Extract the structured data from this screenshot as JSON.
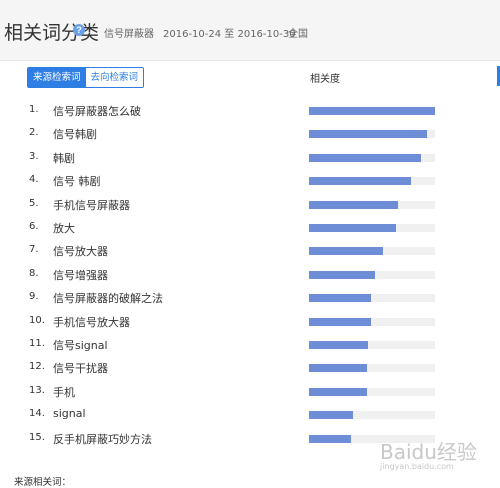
{
  "header": {
    "title": "相关词分类",
    "keyword": "信号屏蔽器",
    "date_range": "2016-10-24 至 2016-10-30",
    "region": "全国",
    "help_icon": "question-circle-icon"
  },
  "tabs": [
    {
      "label": "来源检索词",
      "active": true
    },
    {
      "label": "去向检索词",
      "active": false
    }
  ],
  "column_header": "相关度",
  "rows": [
    {
      "rank": "1.",
      "term": "信号屏蔽器怎么破",
      "relevance": 1.0
    },
    {
      "rank": "2.",
      "term": "信号韩剧",
      "relevance": 0.94
    },
    {
      "rank": "3.",
      "term": "韩剧",
      "relevance": 0.89
    },
    {
      "rank": "4.",
      "term": "信号 韩剧",
      "relevance": 0.81
    },
    {
      "rank": "5.",
      "term": "手机信号屏蔽器",
      "relevance": 0.71
    },
    {
      "rank": "6.",
      "term": "放大",
      "relevance": 0.69
    },
    {
      "rank": "7.",
      "term": "信号放大器",
      "relevance": 0.59
    },
    {
      "rank": "8.",
      "term": "信号增强器",
      "relevance": 0.52
    },
    {
      "rank": "9.",
      "term": "信号屏蔽器的破解之法",
      "relevance": 0.49
    },
    {
      "rank": "10.",
      "term": "手机信号放大器",
      "relevance": 0.49
    },
    {
      "rank": "11.",
      "term": "信号signal",
      "relevance": 0.47
    },
    {
      "rank": "12.",
      "term": "信号干扰器",
      "relevance": 0.46
    },
    {
      "rank": "13.",
      "term": "手机",
      "relevance": 0.46
    },
    {
      "rank": "14.",
      "term": "signal",
      "relevance": 0.35
    },
    {
      "rank": "15.",
      "term": "反手机屏蔽巧妙方法",
      "relevance": 0.33
    }
  ],
  "colors": {
    "bar_fill": "#6d8dd6",
    "bar_track": "#f0f0f0",
    "accent": "#2e7ee4"
  },
  "footer": {
    "label": "来源相关词："
  },
  "watermark": {
    "text": "Baidu经验",
    "sub": "jingyan.baidu.com"
  }
}
